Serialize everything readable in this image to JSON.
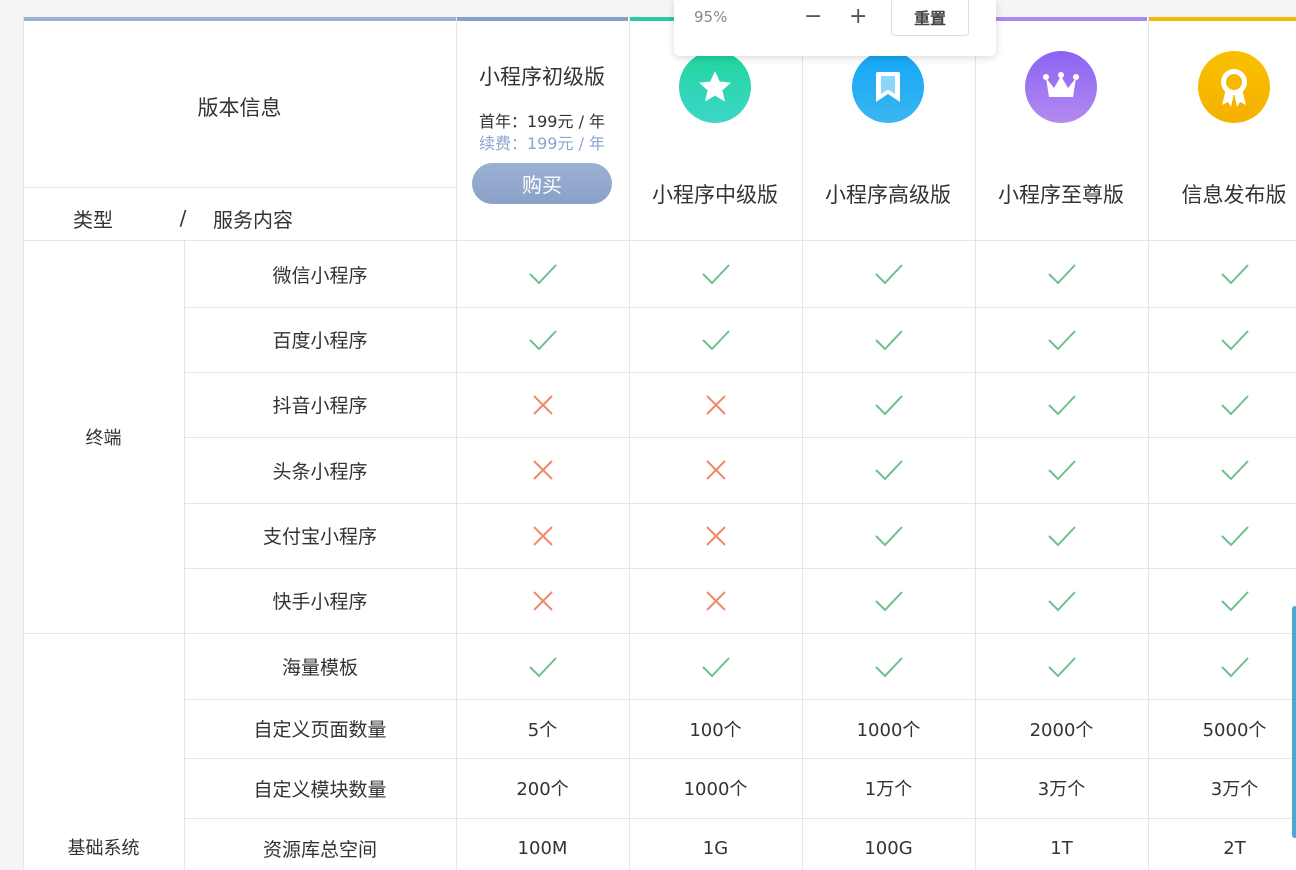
{
  "header": {
    "version_info": "版本信息",
    "type_label": "类型",
    "slash": "/",
    "service_label": "服务内容"
  },
  "plans": [
    {
      "name": "小程序初级版",
      "first_year": "首年：199元 / 年",
      "renew": "续费：199元 / 年",
      "buy_label": "购买",
      "color": "#8aa1c7"
    },
    {
      "name": "小程序中级版",
      "icon": "star-icon",
      "color": "#2bc9a8"
    },
    {
      "name": "小程序高级版",
      "icon": "bookmark-icon",
      "color": "#1fa3ef"
    },
    {
      "name": "小程序至尊版",
      "icon": "crown-icon",
      "color": "#9b6cf0"
    },
    {
      "name": "信息发布版",
      "icon": "medal-icon",
      "color": "#f5b800"
    }
  ],
  "categories": [
    {
      "name": "终端"
    },
    {
      "name": "基础系统"
    }
  ],
  "rows": [
    {
      "feature": "微信小程序",
      "values": [
        "check",
        "check",
        "check",
        "check",
        "check"
      ]
    },
    {
      "feature": "百度小程序",
      "values": [
        "check",
        "check",
        "check",
        "check",
        "check"
      ]
    },
    {
      "feature": "抖音小程序",
      "values": [
        "cross",
        "cross",
        "check",
        "check",
        "check"
      ]
    },
    {
      "feature": "头条小程序",
      "values": [
        "cross",
        "cross",
        "check",
        "check",
        "check"
      ]
    },
    {
      "feature": "支付宝小程序",
      "values": [
        "cross",
        "cross",
        "check",
        "check",
        "check"
      ]
    },
    {
      "feature": "快手小程序",
      "values": [
        "cross",
        "cross",
        "check",
        "check",
        "check"
      ]
    },
    {
      "feature": "海量模板",
      "values": [
        "check",
        "check",
        "check",
        "check",
        "check"
      ]
    },
    {
      "feature": "自定义页面数量",
      "values": [
        "5个",
        "100个",
        "1000个",
        "2000个",
        "5000个"
      ]
    },
    {
      "feature": "自定义模块数量",
      "values": [
        "200个",
        "1000个",
        "1万个",
        "3万个",
        "3万个"
      ]
    },
    {
      "feature": "资源库总空间",
      "values": [
        "100M",
        "1G",
        "100G",
        "1T",
        "2T"
      ]
    }
  ],
  "zoom": {
    "percent": "95%",
    "minus": "−",
    "plus": "+",
    "reset": "重置"
  },
  "colors": {
    "check": "#6cc08b",
    "cross": "#f08a6a",
    "border": "#e6e6e6"
  }
}
